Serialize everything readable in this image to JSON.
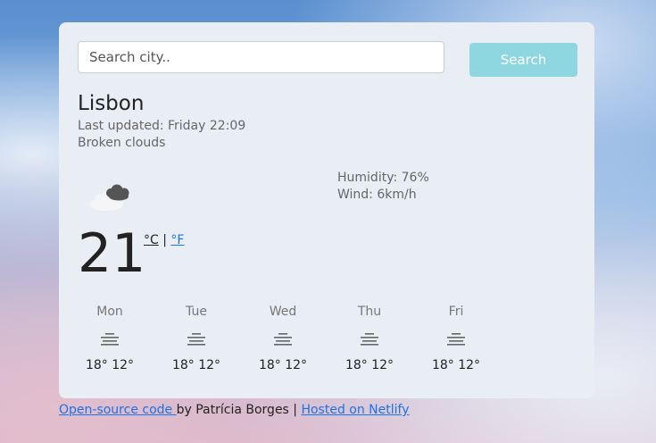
{
  "search": {
    "placeholder": "Search city..",
    "button_label": "Search"
  },
  "current": {
    "city": "Lisbon",
    "last_updated": "Last updated: Friday 22:09",
    "description": "Broken clouds",
    "icon": "broken-clouds-icon",
    "temperature": "21",
    "unit_c": "°C",
    "unit_separator": "|",
    "unit_f": "°F",
    "humidity": "Humidity: 76%",
    "wind": "Wind: 6km/h"
  },
  "forecast": [
    {
      "day": "Mon",
      "icon": "mist-icon",
      "temps": "18° 12°"
    },
    {
      "day": "Tue",
      "icon": "mist-icon",
      "temps": "18° 12°"
    },
    {
      "day": "Wed",
      "icon": "mist-icon",
      "temps": "18° 12°"
    },
    {
      "day": "Thu",
      "icon": "mist-icon",
      "temps": "18° 12°"
    },
    {
      "day": "Fri",
      "icon": "mist-icon",
      "temps": "18° 12°"
    }
  ],
  "footer": {
    "source_link": "Open-source code ",
    "author": "by Patrícia Borges | ",
    "hosted_link": "Hosted on Netlify"
  },
  "colors": {
    "button": "#8fd7e0",
    "link": "#1a73e8",
    "card": "#e9edf4"
  }
}
